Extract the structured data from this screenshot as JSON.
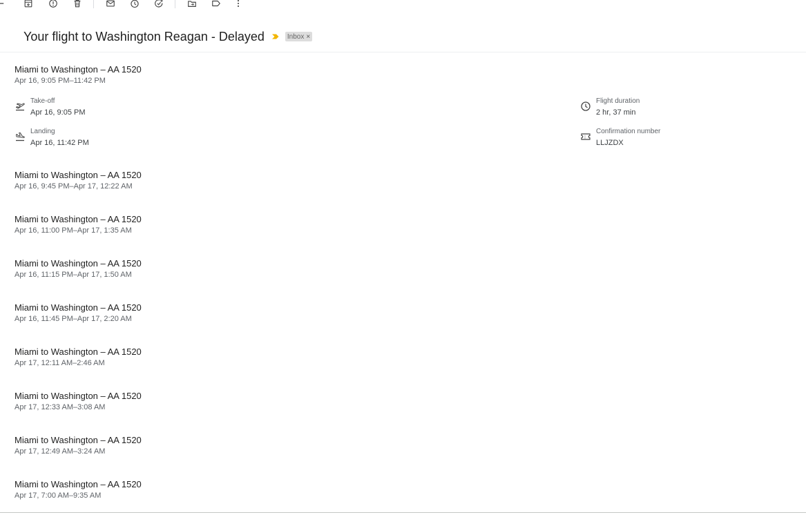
{
  "toolbar": {
    "icons": [
      "back-arrow-icon",
      "archive-icon",
      "report-spam-icon",
      "delete-icon",
      "mark-unread-icon",
      "snooze-icon",
      "add-to-tasks-icon",
      "move-to-icon",
      "label-icon",
      "more-options-icon"
    ]
  },
  "email": {
    "subject": "Your flight to Washington Reagan - Delayed",
    "label_chip": "Inbox",
    "label_close": "×",
    "importance_color": "#f2b600"
  },
  "flights": [
    {
      "title": "Miami to Washington – AA 1520",
      "time": "Apr 16, 9:05 PM–11:42 PM"
    },
    {
      "title": "Miami to Washington – AA 1520",
      "time": "Apr 16, 9:45 PM–Apr 17, 12:22 AM"
    },
    {
      "title": "Miami to Washington – AA 1520",
      "time": "Apr 16, 11:00 PM–Apr 17, 1:35 AM"
    },
    {
      "title": "Miami to Washington – AA 1520",
      "time": "Apr 16, 11:15 PM–Apr 17, 1:50 AM"
    },
    {
      "title": "Miami to Washington – AA 1520",
      "time": "Apr 16, 11:45 PM–Apr 17, 2:20 AM"
    },
    {
      "title": "Miami to Washington – AA 1520",
      "time": "Apr 17, 12:11 AM–2:46 AM"
    },
    {
      "title": "Miami to Washington – AA 1520",
      "time": "Apr 17, 12:33 AM–3:08 AM"
    },
    {
      "title": "Miami to Washington – AA 1520",
      "time": "Apr 17, 12:49 AM–3:24 AM"
    },
    {
      "title": "Miami to Washington – AA 1520",
      "time": "Apr 17, 7:00 AM–9:35 AM"
    }
  ],
  "details": {
    "takeoff": {
      "label": "Take-off",
      "value": "Apr 16, 9:05 PM",
      "icon": "flight-takeoff-icon"
    },
    "landing": {
      "label": "Landing",
      "value": "Apr 16, 11:42 PM",
      "icon": "flight-land-icon"
    },
    "duration": {
      "label": "Flight duration",
      "value": "2 hr, 37 min",
      "icon": "clock-icon"
    },
    "confirmation": {
      "label": "Confirmation number",
      "value": "LLJZDX",
      "icon": "ticket-icon"
    }
  }
}
